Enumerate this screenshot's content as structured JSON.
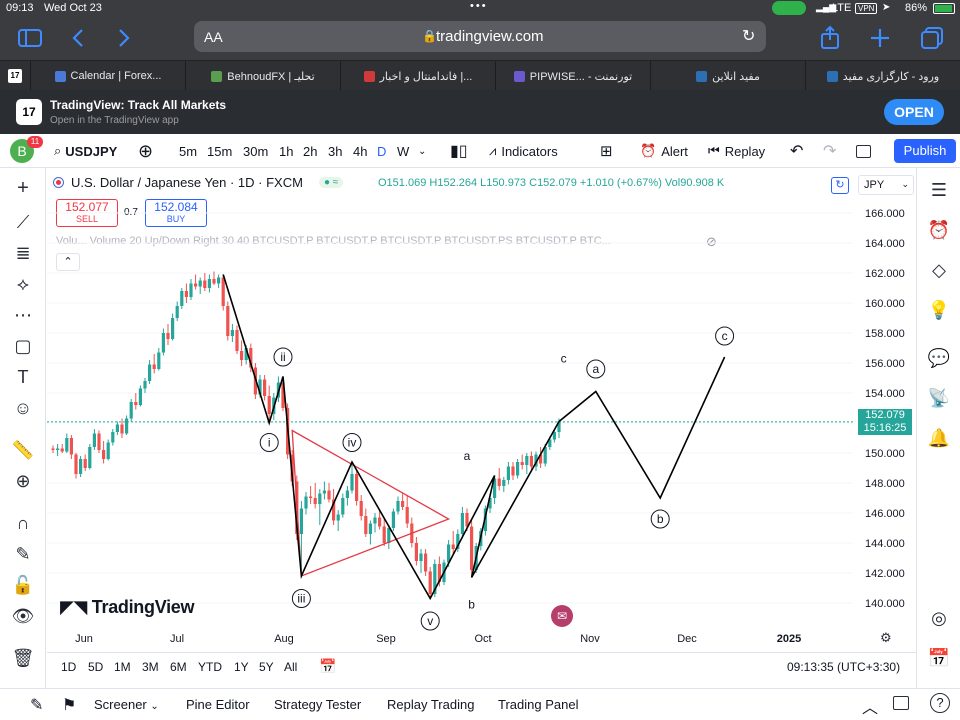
{
  "status_bar": {
    "time": "09:13",
    "date": "Wed Oct 23",
    "network": "LTE",
    "vpn": "VPN",
    "battery": "86%"
  },
  "safari": {
    "text_size": "AA",
    "url": "tradingview.com"
  },
  "tabs": [
    {
      "label": "Calendar | Forex...",
      "color": "#4a7ad8"
    },
    {
      "label": "BehnoudFX | تحلیـ",
      "color": "#5c9e4f"
    },
    {
      "label": "فاندامنتال و اخبار |...",
      "color": "#d13a3a"
    },
    {
      "label": "PIPWISE... - تورنمنت",
      "color": "#6a5acd"
    },
    {
      "label": "مفید انلاین",
      "color": "#2d6fb3"
    },
    {
      "label": "ورود - کارگزاری مفید",
      "color": "#2d6fb3"
    }
  ],
  "banner": {
    "title": "TradingView: Track All Markets",
    "subtitle": "Open in the TradingView app",
    "open_label": "OPEN"
  },
  "toolbar": {
    "avatar_letter": "B",
    "avatar_badge": "11",
    "symbol": "USDJPY",
    "intervals": [
      "5m",
      "15m",
      "30m",
      "1h",
      "2h",
      "3h",
      "4h",
      "D",
      "W"
    ],
    "indicators_label": "Indicators",
    "alert_label": "Alert",
    "replay_label": "Replay",
    "publish_label": "Publish"
  },
  "chart_header": {
    "title": "U.S. Dollar / Japanese Yen · 1D · FXCM",
    "open": "O151.069",
    "high": "H152.264",
    "low": "L150.973",
    "close": "C152.079",
    "change": "+1.010 (+0.67%)",
    "vol": "Vol90.908 K",
    "currency": "JPY",
    "sell_price": "152.077",
    "sell_label": "SELL",
    "spread": "0.7",
    "buy_price": "152.084",
    "buy_label": "BUY",
    "volume_legend": "Volu... Volume 20 Up/Down Right 30 40 BTCUSDT.P BTCUSDT.P BTCUSDT.P BTCUSDT.PS BTCUSDT.P BTC..."
  },
  "chart_data": {
    "type": "candlestick",
    "symbol": "USDJPY",
    "interval": "1D",
    "y_ticks": [
      "166.000",
      "164.000",
      "162.000",
      "160.000",
      "158.000",
      "156.000",
      "154.000",
      "152.000",
      "150.000",
      "148.000",
      "146.000",
      "144.000",
      "142.000",
      "140.000"
    ],
    "x_ticks": [
      "Jun",
      "Jul",
      "Aug",
      "Sep",
      "Oct",
      "Nov",
      "Dec",
      "2025"
    ],
    "ylim": [
      139,
      167
    ],
    "last_price": "152.079",
    "countdown": "15:16:25",
    "candles": [
      [
        0,
        150.3,
        150.5,
        150.0,
        150.2
      ],
      [
        1,
        150.2,
        150.6,
        149.8,
        150.3
      ],
      [
        2,
        150.3,
        150.6,
        150.0,
        150.1
      ],
      [
        3,
        150.1,
        151.3,
        150.0,
        151.0
      ],
      [
        4,
        151.0,
        151.2,
        149.6,
        149.9
      ],
      [
        5,
        149.9,
        150.0,
        148.3,
        148.6
      ],
      [
        6,
        148.6,
        149.8,
        148.4,
        149.6
      ],
      [
        7,
        149.6,
        149.9,
        148.8,
        149.0
      ],
      [
        8,
        149.0,
        150.6,
        148.9,
        150.4
      ],
      [
        9,
        150.4,
        151.6,
        150.2,
        151.3
      ],
      [
        10,
        151.3,
        151.5,
        150.0,
        150.2
      ],
      [
        11,
        150.2,
        150.8,
        149.3,
        149.6
      ],
      [
        12,
        149.6,
        150.9,
        149.5,
        150.7
      ],
      [
        13,
        150.7,
        151.6,
        150.5,
        151.4
      ],
      [
        14,
        151.4,
        152.1,
        151.2,
        151.9
      ],
      [
        15,
        151.9,
        152.3,
        151.0,
        151.3
      ],
      [
        16,
        151.3,
        152.5,
        151.2,
        152.3
      ],
      [
        17,
        152.3,
        153.6,
        152.1,
        153.4
      ],
      [
        18,
        153.4,
        154.0,
        152.9,
        153.2
      ],
      [
        19,
        153.2,
        154.5,
        153.1,
        154.3
      ],
      [
        20,
        154.3,
        155.0,
        154.0,
        154.8
      ],
      [
        21,
        154.8,
        156.2,
        154.6,
        155.9
      ],
      [
        22,
        155.9,
        156.6,
        155.3,
        155.6
      ],
      [
        23,
        155.6,
        157.0,
        155.5,
        156.7
      ],
      [
        24,
        156.7,
        158.3,
        156.5,
        158.0
      ],
      [
        25,
        158.0,
        158.6,
        157.2,
        157.6
      ],
      [
        26,
        157.6,
        159.3,
        157.5,
        159.0
      ],
      [
        27,
        159.0,
        160.1,
        158.8,
        159.8
      ],
      [
        28,
        159.8,
        161.0,
        159.6,
        160.8
      ],
      [
        29,
        160.8,
        161.3,
        160.0,
        160.4
      ],
      [
        30,
        160.4,
        161.6,
        160.2,
        161.3
      ],
      [
        31,
        161.3,
        161.9,
        160.9,
        161.1
      ],
      [
        32,
        161.1,
        161.7,
        160.6,
        161.5
      ],
      [
        33,
        161.5,
        162.0,
        160.8,
        161.0
      ],
      [
        34,
        161.0,
        161.9,
        160.7,
        161.6
      ],
      [
        35,
        161.6,
        162.1,
        161.2,
        161.3
      ],
      [
        36,
        161.3,
        161.9,
        161.0,
        161.7
      ],
      [
        37,
        161.7,
        161.9,
        159.5,
        159.8
      ],
      [
        38,
        159.8,
        160.1,
        157.5,
        157.8
      ],
      [
        39,
        157.8,
        158.6,
        157.4,
        158.2
      ],
      [
        40,
        158.2,
        158.5,
        156.6,
        156.8
      ],
      [
        41,
        156.8,
        157.5,
        155.8,
        156.2
      ],
      [
        42,
        156.2,
        157.2,
        155.9,
        157.0
      ],
      [
        43,
        157.0,
        157.3,
        155.4,
        155.7
      ],
      [
        44,
        155.7,
        156.0,
        153.6,
        153.9
      ],
      [
        45,
        153.9,
        155.2,
        153.7,
        154.9
      ],
      [
        46,
        154.9,
        155.2,
        153.5,
        153.8
      ],
      [
        47,
        153.8,
        154.5,
        152.0,
        152.6
      ],
      [
        48,
        152.6,
        154.0,
        152.2,
        153.7
      ],
      [
        49,
        153.7,
        155.1,
        153.4,
        154.7
      ],
      [
        50,
        154.7,
        155.1,
        152.8,
        153.0
      ],
      [
        51,
        153.0,
        153.3,
        149.6,
        149.9
      ],
      [
        52,
        149.9,
        150.2,
        147.8,
        148.1
      ],
      [
        53,
        148.1,
        148.5,
        144.2,
        144.6
      ],
      [
        54,
        144.6,
        146.8,
        141.8,
        146.3
      ],
      [
        55,
        146.3,
        147.4,
        145.9,
        147.1
      ],
      [
        56,
        147.1,
        147.8,
        146.6,
        147.0
      ],
      [
        57,
        147.0,
        148.0,
        146.3,
        146.6
      ],
      [
        58,
        146.6,
        147.6,
        145.2,
        147.3
      ],
      [
        59,
        147.3,
        148.1,
        146.9,
        147.5
      ],
      [
        60,
        147.5,
        148.0,
        146.7,
        146.9
      ],
      [
        61,
        146.9,
        147.6,
        145.2,
        145.5
      ],
      [
        62,
        145.5,
        146.2,
        144.8,
        145.9
      ],
      [
        63,
        145.9,
        147.3,
        145.7,
        147.0
      ],
      [
        64,
        147.0,
        147.8,
        146.5,
        147.5
      ],
      [
        65,
        147.5,
        149.4,
        147.3,
        148.6
      ],
      [
        66,
        148.6,
        148.8,
        146.5,
        146.8
      ],
      [
        67,
        146.8,
        147.2,
        145.5,
        145.8
      ],
      [
        68,
        145.8,
        146.3,
        144.4,
        144.6
      ],
      [
        69,
        144.6,
        145.5,
        143.9,
        145.3
      ],
      [
        70,
        145.3,
        146.0,
        144.7,
        145.7
      ],
      [
        71,
        145.7,
        146.2,
        144.9,
        145.1
      ],
      [
        72,
        145.1,
        145.6,
        143.8,
        144.0
      ],
      [
        73,
        144.0,
        145.2,
        143.6,
        145.0
      ],
      [
        74,
        145.0,
        146.3,
        144.8,
        146.1
      ],
      [
        75,
        146.1,
        147.1,
        145.9,
        146.8
      ],
      [
        76,
        146.8,
        147.3,
        146.2,
        146.4
      ],
      [
        77,
        146.4,
        147.2,
        145.0,
        145.3
      ],
      [
        78,
        145.3,
        145.7,
        143.7,
        144.0
      ],
      [
        79,
        144.0,
        144.4,
        142.5,
        142.8
      ],
      [
        80,
        142.8,
        143.6,
        142.0,
        143.3
      ],
      [
        81,
        143.3,
        143.6,
        141.8,
        142.1
      ],
      [
        82,
        142.1,
        142.4,
        140.3,
        140.6
      ],
      [
        83,
        140.6,
        142.9,
        140.4,
        142.6
      ],
      [
        84,
        142.6,
        143.1,
        141.1,
        141.4
      ],
      [
        85,
        141.4,
        142.9,
        141.2,
        142.7
      ],
      [
        86,
        142.7,
        144.2,
        142.4,
        143.9
      ],
      [
        87,
        143.9,
        144.8,
        143.2,
        143.6
      ],
      [
        88,
        143.6,
        144.9,
        143.4,
        144.6
      ],
      [
        89,
        144.6,
        146.4,
        144.3,
        146.0
      ],
      [
        90,
        146.0,
        146.3,
        144.8,
        145.1
      ],
      [
        91,
        145.1,
        145.5,
        141.7,
        142.2
      ],
      [
        92,
        142.2,
        144.0,
        142.0,
        143.8
      ],
      [
        93,
        143.8,
        145.0,
        143.5,
        144.8
      ],
      [
        94,
        144.8,
        146.5,
        144.5,
        146.3
      ],
      [
        95,
        146.3,
        147.3,
        146.0,
        147.0
      ],
      [
        96,
        147.0,
        148.5,
        146.6,
        148.3
      ],
      [
        97,
        148.3,
        149.0,
        147.5,
        147.8
      ],
      [
        98,
        147.8,
        148.4,
        147.4,
        148.2
      ],
      [
        99,
        148.2,
        149.4,
        147.9,
        149.1
      ],
      [
        100,
        149.1,
        149.4,
        148.2,
        148.5
      ],
      [
        101,
        148.5,
        149.6,
        148.3,
        149.4
      ],
      [
        102,
        149.4,
        149.9,
        148.9,
        149.2
      ],
      [
        103,
        149.2,
        150.0,
        148.6,
        149.8
      ],
      [
        104,
        149.8,
        150.1,
        148.9,
        149.1
      ],
      [
        105,
        149.1,
        150.1,
        148.8,
        149.9
      ],
      [
        106,
        149.9,
        150.4,
        149.0,
        149.3
      ],
      [
        107,
        149.3,
        150.6,
        149.1,
        150.4
      ],
      [
        108,
        150.4,
        151.1,
        150.2,
        150.9
      ],
      [
        109,
        150.9,
        151.6,
        150.7,
        151.4
      ],
      [
        110,
        151.4,
        152.3,
        151.0,
        152.1
      ]
    ],
    "zigzag": [
      [
        37,
        161.9
      ],
      [
        47,
        152.0
      ],
      [
        50,
        155.1
      ],
      [
        54,
        141.8
      ],
      [
        65,
        149.4
      ],
      [
        82,
        140.3
      ],
      [
        96,
        148.5
      ],
      [
        91,
        141.7
      ],
      [
        110,
        152.1
      ]
    ],
    "projection": [
      [
        110,
        152.1
      ],
      [
        118,
        154.1
      ],
      [
        132,
        147.0
      ],
      [
        146,
        156.4
      ]
    ],
    "triangle": [
      [
        52,
        151.5
      ],
      [
        86,
        145.6
      ],
      [
        54,
        141.8
      ]
    ],
    "wave_labels": [
      {
        "text": "i",
        "x": 47,
        "y": 150.7,
        "circled": true
      },
      {
        "text": "ii",
        "x": 50,
        "y": 156.4,
        "circled": true
      },
      {
        "text": "iii",
        "x": 54,
        "y": 140.3,
        "circled": true
      },
      {
        "text": "iv",
        "x": 65,
        "y": 150.7,
        "circled": true
      },
      {
        "text": "v",
        "x": 82,
        "y": 138.8,
        "circled": true
      },
      {
        "text": "a",
        "x": 90,
        "y": 149.8,
        "circled": false
      },
      {
        "text": "b",
        "x": 91,
        "y": 139.9,
        "circled": false
      },
      {
        "text": "c",
        "x": 111,
        "y": 156.3,
        "circled": false
      },
      {
        "text": "a",
        "x": 118,
        "y": 155.6,
        "circled": true
      },
      {
        "text": "b",
        "x": 132,
        "y": 145.6,
        "circled": true
      },
      {
        "text": "c",
        "x": 146,
        "y": 157.8,
        "circled": true
      }
    ],
    "colors": {
      "up": "#26a69a",
      "down": "#ef5350",
      "triangle": "#e53945",
      "line": "#000000",
      "price_tag": "#26a69a"
    }
  },
  "chart_footer": {
    "ranges": [
      "1D",
      "5D",
      "1M",
      "3M",
      "6M",
      "YTD",
      "1Y",
      "5Y",
      "All"
    ],
    "clock": "09:13:35 (UTC+3:30)",
    "watermark": "TradingView"
  },
  "bottom_bar": {
    "screener": "Screener",
    "pine_editor": "Pine Editor",
    "strategy_tester": "Strategy Tester",
    "replay_trading": "Replay Trading",
    "trading_panel": "Trading Panel"
  }
}
